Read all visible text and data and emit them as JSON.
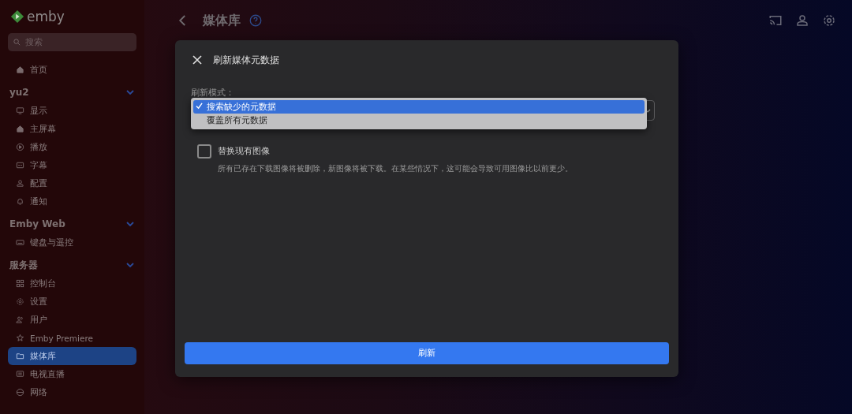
{
  "sidebar": {
    "logo": "emby",
    "search": {
      "placeholder": "搜索"
    },
    "home": {
      "label": "首页",
      "selected": false
    },
    "sections": [
      {
        "title": "yu2",
        "expanded": true,
        "items": [
          {
            "label": "显示",
            "selected": false
          },
          {
            "label": "主屏幕",
            "selected": false
          },
          {
            "label": "播放",
            "selected": false
          },
          {
            "label": "字幕",
            "selected": false
          },
          {
            "label": "配置",
            "selected": false
          },
          {
            "label": "通知",
            "selected": false
          }
        ]
      },
      {
        "title": "Emby Web",
        "expanded": true,
        "items": [
          {
            "label": "键盘与遥控",
            "selected": false
          }
        ]
      },
      {
        "title": "服务器",
        "expanded": true,
        "items": [
          {
            "label": "控制台",
            "selected": false
          },
          {
            "label": "设置",
            "selected": false
          },
          {
            "label": "用户",
            "selected": false
          },
          {
            "label": "Emby Premiere",
            "selected": false
          },
          {
            "label": "媒体库",
            "selected": true
          },
          {
            "label": "电视直播",
            "selected": false
          },
          {
            "label": "网络",
            "selected": false
          }
        ]
      }
    ]
  },
  "header": {
    "title": "媒体库"
  },
  "dialog": {
    "title": "刷新媒体元数据",
    "mode_label": "刷新模式：",
    "options": [
      {
        "label": "搜索缺少的元数据",
        "selected": true
      },
      {
        "label": "覆盖所有元数据",
        "selected": false
      }
    ],
    "replace_images": {
      "label": "替换现有图像",
      "checked": false,
      "description": "所有已存在下载图像将被删除，新图像将被下载。在某些情况下，这可能会导致可用图像比以前更少。"
    },
    "submit": "刷新"
  }
}
